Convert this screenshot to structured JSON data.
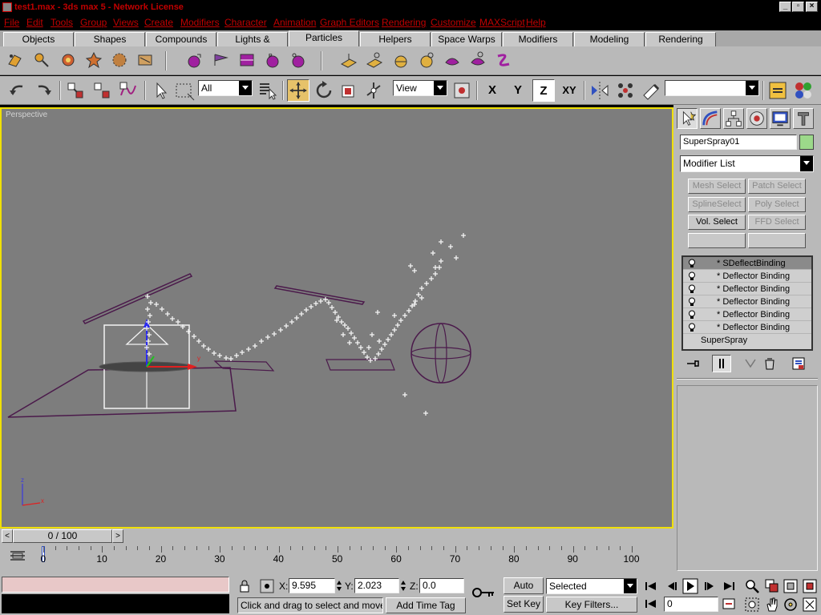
{
  "window": {
    "title": "test1.max - 3ds max 5 - Network License",
    "buttons": [
      "minimize",
      "maximize",
      "close"
    ]
  },
  "menu": [
    "File",
    "Edit",
    "Tools",
    "Group",
    "Views",
    "Create",
    "Modifiers",
    "Character",
    "Animation",
    "Graph Editors",
    "Rendering",
    "Customize",
    "MAXScript",
    "Help"
  ],
  "tabs": [
    "Objects",
    "Shapes",
    "Compounds",
    "Lights & Cameras",
    "Particles",
    "Helpers",
    "Space Warps",
    "Modifiers",
    "Modeling",
    "Rendering"
  ],
  "active_tab": "Particles",
  "toolbar": {
    "selection_filter": "All",
    "reference_coord": "View",
    "axis_buttons": [
      "X",
      "Y",
      "Z",
      "XY"
    ],
    "active_axis": "Z",
    "named_selection": ""
  },
  "viewport": {
    "label": "Perspective",
    "axis_labels": {
      "z": "z",
      "x": "x"
    },
    "gizmo_label": "y"
  },
  "command_panel": {
    "object_name": "SuperSpray01",
    "object_color": "#9cd98a",
    "modifier_list_label": "Modifier List",
    "buttons": [
      {
        "label": "Mesh Select",
        "enabled": false
      },
      {
        "label": "Patch Select",
        "enabled": false
      },
      {
        "label": "SplineSelect",
        "enabled": false
      },
      {
        "label": "Poly Select",
        "enabled": false
      },
      {
        "label": "Vol. Select",
        "enabled": true
      },
      {
        "label": "FFD Select",
        "enabled": false
      },
      {
        "label": "",
        "enabled": false
      },
      {
        "label": "",
        "enabled": false
      }
    ],
    "stack": [
      {
        "label": "* SDeflectBinding",
        "selected": true
      },
      {
        "label": "* Deflector Binding",
        "selected": false
      },
      {
        "label": "* Deflector Binding",
        "selected": false
      },
      {
        "label": "* Deflector Binding",
        "selected": false
      },
      {
        "label": "* Deflector Binding",
        "selected": false
      },
      {
        "label": "* Deflector Binding",
        "selected": false
      }
    ],
    "stack_base": "SuperSpray"
  },
  "time": {
    "slider_text": "0 / 100",
    "frame_labels": [
      "0",
      "10",
      "20",
      "30",
      "40",
      "50",
      "60",
      "70",
      "80",
      "90",
      "100"
    ]
  },
  "status": {
    "x_value": "9.595",
    "y_value": "2.023",
    "z_value": "0.0",
    "x_label": "X:",
    "y_label": "Y:",
    "z_label": "Z:",
    "prompt": "Click and drag to select and move obj",
    "add_time_tag": "Add Time Tag",
    "auto_key": "Auto Key",
    "set_key": "Set Key",
    "key_mode": "Selected",
    "key_filters": "Key Filters...",
    "current_frame": "0"
  }
}
